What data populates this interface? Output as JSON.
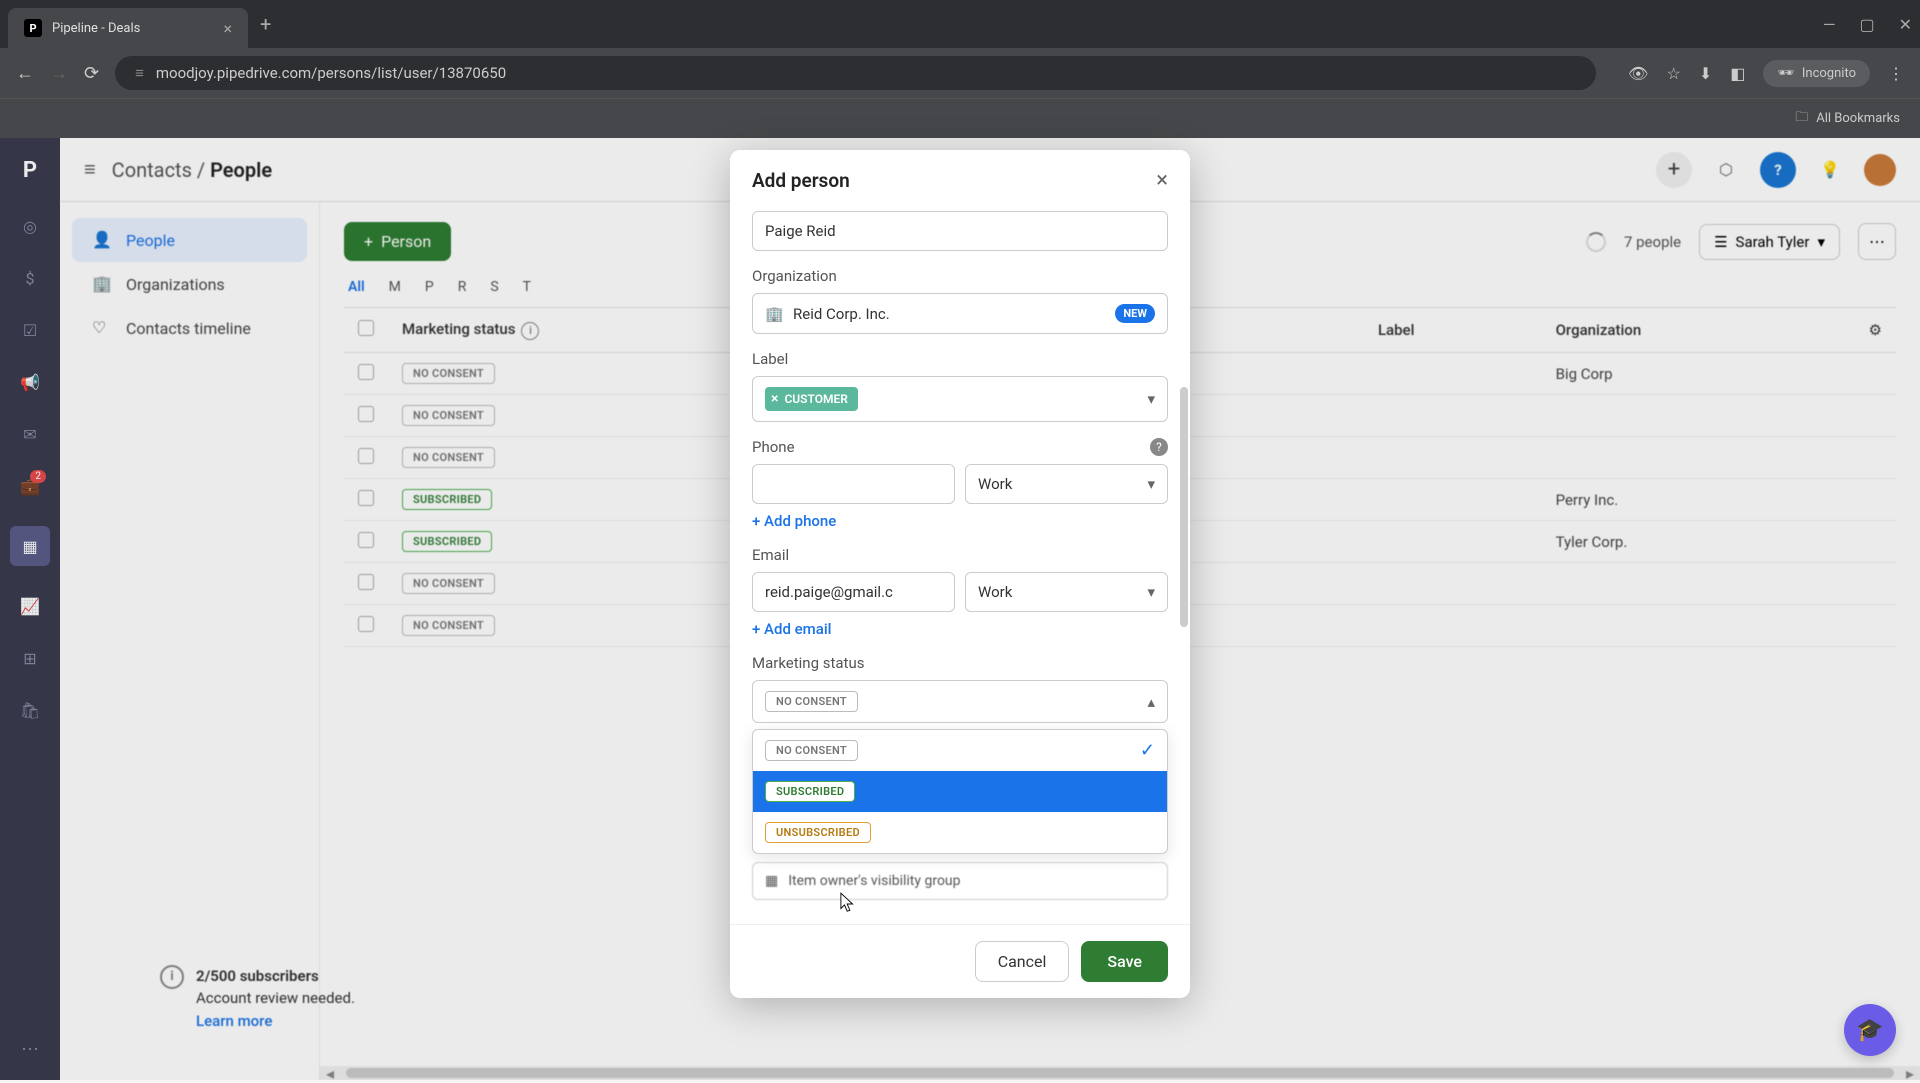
{
  "browser": {
    "tab_title": "Pipeline - Deals",
    "tab_icon_letter": "P",
    "url": "moodjoy.pipedrive.com/persons/list/user/13870650",
    "incognito_label": "Incognito",
    "bookmarks_label": "All Bookmarks"
  },
  "rail": {
    "logo_letter": "P",
    "badge_count": "2"
  },
  "topbar": {
    "breadcrumb_parent": "Contacts",
    "breadcrumb_current": "People"
  },
  "sidebar": {
    "people": "People",
    "organizations": "Organizations",
    "timeline": "Contacts timeline"
  },
  "subscribers": {
    "count": "2/500 subscribers",
    "line1": "Account review needed.",
    "link": "Learn more"
  },
  "toolbar": {
    "person_btn": "Person",
    "people_count": "7 people",
    "filter_user": "Sarah Tyler"
  },
  "tabs": {
    "all": "All",
    "m": "M",
    "p": "P",
    "r": "R",
    "s": "S",
    "t": "T"
  },
  "table": {
    "col_marketing": "Marketing status",
    "col_label": "Label",
    "col_org": "Organization",
    "rows": [
      {
        "status": "NO CONSENT",
        "status_class": "pill-noconsent",
        "org": "Big Corp"
      },
      {
        "status": "NO CONSENT",
        "status_class": "pill-noconsent",
        "org": ""
      },
      {
        "status": "NO CONSENT",
        "status_class": "pill-noconsent",
        "org": ""
      },
      {
        "status": "SUBSCRIBED",
        "status_class": "pill-subscribed",
        "org": "Perry Inc."
      },
      {
        "status": "SUBSCRIBED",
        "status_class": "pill-subscribed",
        "org": "Tyler Corp."
      },
      {
        "status": "NO CONSENT",
        "status_class": "pill-noconsent",
        "org": ""
      },
      {
        "status": "NO CONSENT",
        "status_class": "pill-noconsent",
        "org": ""
      }
    ]
  },
  "modal": {
    "title": "Add person",
    "name_value": "Paige Reid",
    "org_label": "Organization",
    "org_value": "Reid Corp. Inc.",
    "new_badge": "NEW",
    "label_label": "Label",
    "label_chip": "CUSTOMER",
    "phone_label": "Phone",
    "phone_type": "Work",
    "add_phone": "+ Add phone",
    "email_label": "Email",
    "email_value": "reid.paige@gmail.c",
    "email_type": "Work",
    "add_email": "+ Add email",
    "marketing_label": "Marketing status",
    "marketing_selected": "NO CONSENT",
    "dropdown": {
      "opt1": "NO CONSENT",
      "opt2": "SUBSCRIBED",
      "opt3": "UNSUBSCRIBED"
    },
    "visibility_hint": "Item owner's visibility group",
    "cancel": "Cancel",
    "save": "Save"
  }
}
